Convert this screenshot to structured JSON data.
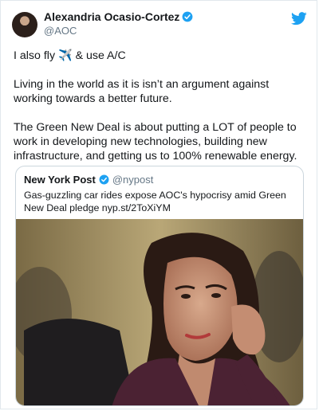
{
  "tweet": {
    "author": {
      "display_name": "Alexandria Ocasio-Cortez",
      "handle": "@AOC",
      "verified": true
    },
    "paragraphs": [
      "I also fly ✈️ & use A/C",
      "Living in the world as it is isn’t an argument against working towards a better future.",
      "The Green New Deal is about putting a LOT of people to work in developing new technologies, building new infrastructure, and getting us to 100% renewable energy."
    ],
    "paragraph1_parts": {
      "before": "I also fly ",
      "emoji": "✈️",
      "after": " & use A/C"
    }
  },
  "quoted_tweet": {
    "author": {
      "display_name": "New York Post",
      "handle": "@nypost",
      "verified": true
    },
    "text": "Gas-guzzling car rides expose AOC's hypocrisy amid Green New Deal pledge nyp.st/2ToXiYM",
    "image": {
      "description_icon": "photo-of-woman-in-hearing"
    }
  },
  "icons": {
    "brand": "twitter-bird-icon",
    "verified": "verified-badge-icon"
  },
  "colors": {
    "twitter_blue": "#1da1f2",
    "text": "#14171a",
    "muted": "#657786",
    "border": "#ccd6dd"
  }
}
